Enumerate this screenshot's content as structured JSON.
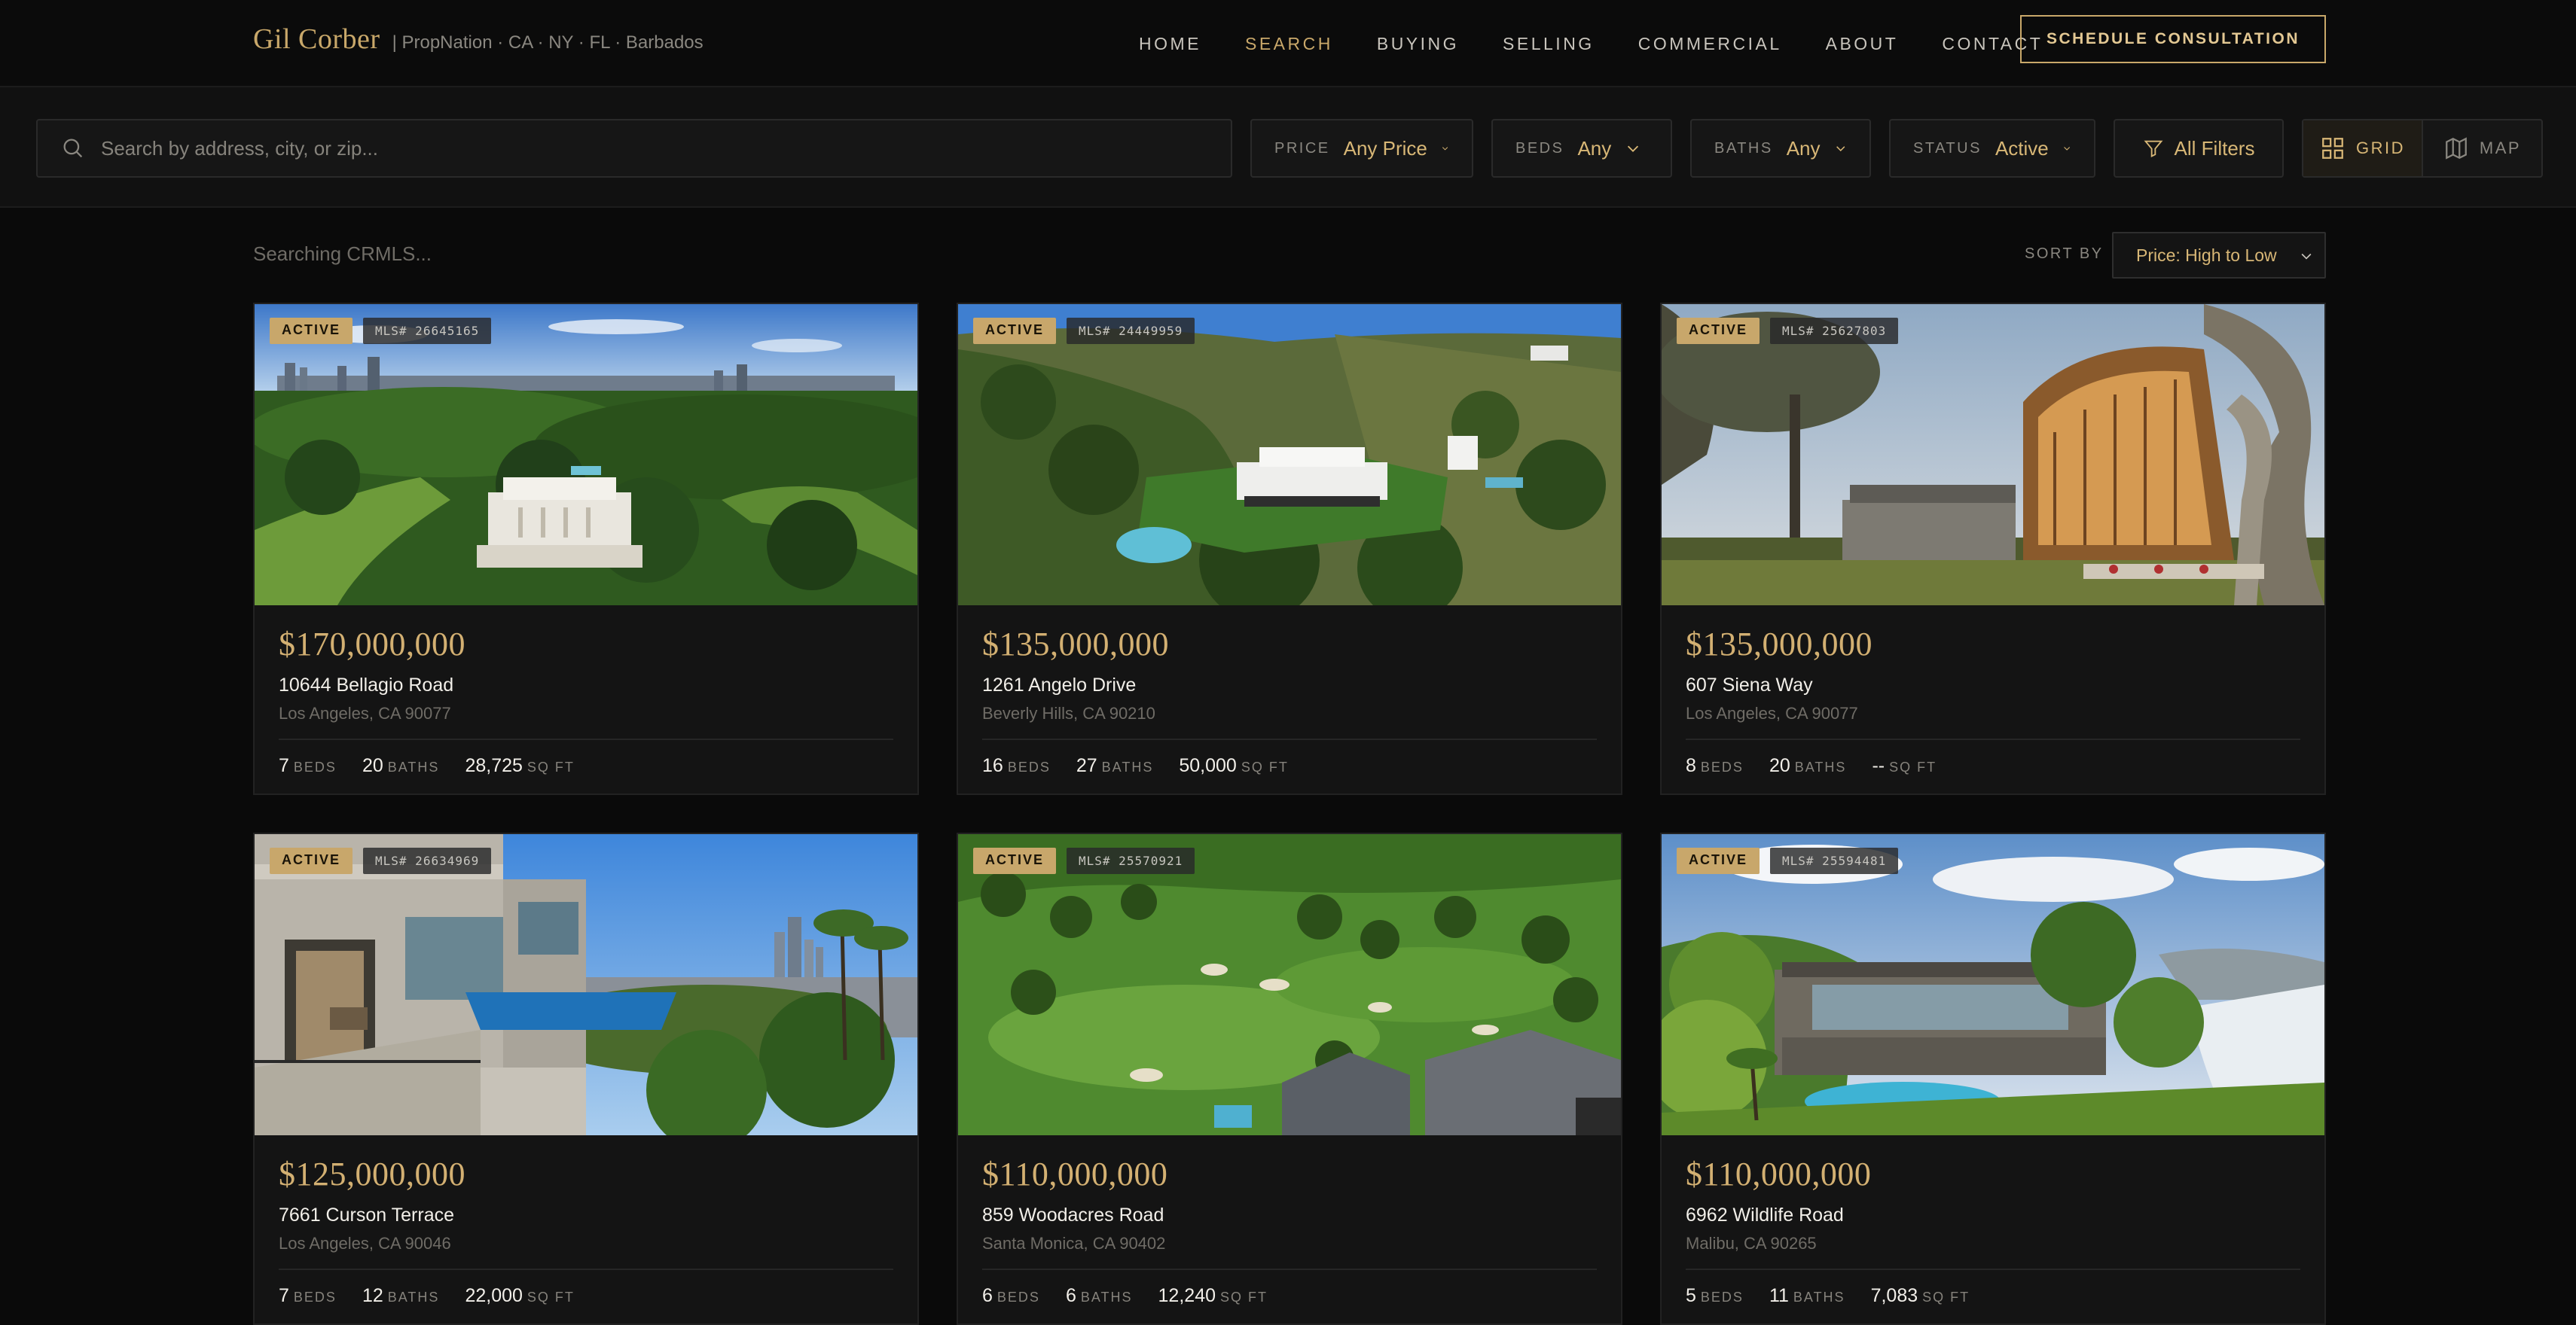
{
  "header": {
    "brand_name": "Gil Corber",
    "brand_sub": "| PropNation · CA · NY · FL · Barbados",
    "nav": [
      "HOME",
      "SEARCH",
      "BUYING",
      "SELLING",
      "COMMERCIAL",
      "ABOUT",
      "CONTACT"
    ],
    "nav_active": "SEARCH",
    "cta": "SCHEDULE CONSULTATION"
  },
  "filters": {
    "search_placeholder": "Search by address, city, or zip...",
    "price": {
      "label": "PRICE",
      "value": "Any Price"
    },
    "beds": {
      "label": "BEDS",
      "value": "Any"
    },
    "baths": {
      "label": "BATHS",
      "value": "Any"
    },
    "status": {
      "label": "STATUS",
      "value": "Active"
    },
    "all_filters": "All Filters",
    "view_grid": "GRID",
    "view_map": "MAP"
  },
  "results": {
    "status_text": "Searching CRMLS...",
    "sort_label": "SORT BY",
    "sort_value": "Price: High to Low"
  },
  "colors": {
    "accent": "#c9a86a",
    "background": "#0a0a0a",
    "card": "#141414"
  },
  "listings": [
    {
      "status": "ACTIVE",
      "mls": "MLS# 26645165",
      "price": "$170,000,000",
      "address": "10644 Bellagio Road",
      "city": "Los Angeles, CA 90077",
      "beds": "7",
      "baths": "20",
      "sqft": "28,725",
      "beds_unit": "BEDS",
      "baths_unit": "BATHS",
      "sqft_unit": "SQ FT"
    },
    {
      "status": "ACTIVE",
      "mls": "MLS# 24449959",
      "price": "$135,000,000",
      "address": "1261 Angelo Drive",
      "city": "Beverly Hills, CA 90210",
      "beds": "16",
      "baths": "27",
      "sqft": "50,000",
      "beds_unit": "BEDS",
      "baths_unit": "BATHS",
      "sqft_unit": "SQ FT"
    },
    {
      "status": "ACTIVE",
      "mls": "MLS# 25627803",
      "price": "$135,000,000",
      "address": "607 Siena Way",
      "city": "Los Angeles, CA 90077",
      "beds": "8",
      "baths": "20",
      "sqft": "--",
      "beds_unit": "BEDS",
      "baths_unit": "BATHS",
      "sqft_unit": "SQ FT"
    },
    {
      "status": "ACTIVE",
      "mls": "MLS# 26634969",
      "price": "$125,000,000",
      "address": "7661 Curson Terrace",
      "city": "Los Angeles, CA 90046",
      "beds": "7",
      "baths": "12",
      "sqft": "22,000",
      "beds_unit": "BEDS",
      "baths_unit": "BATHS",
      "sqft_unit": "SQ FT"
    },
    {
      "status": "ACTIVE",
      "mls": "MLS# 25570921",
      "price": "$110,000,000",
      "address": "859 Woodacres Road",
      "city": "Santa Monica, CA 90402",
      "beds": "6",
      "baths": "6",
      "sqft": "12,240",
      "beds_unit": "BEDS",
      "baths_unit": "BATHS",
      "sqft_unit": "SQ FT"
    },
    {
      "status": "ACTIVE",
      "mls": "MLS# 25594481",
      "price": "$110,000,000",
      "address": "6962 Wildlife Road",
      "city": "Malibu, CA 90265",
      "beds": "5",
      "baths": "11",
      "sqft": "7,083",
      "beds_unit": "BEDS",
      "baths_unit": "BATHS",
      "sqft_unit": "SQ FT"
    }
  ]
}
